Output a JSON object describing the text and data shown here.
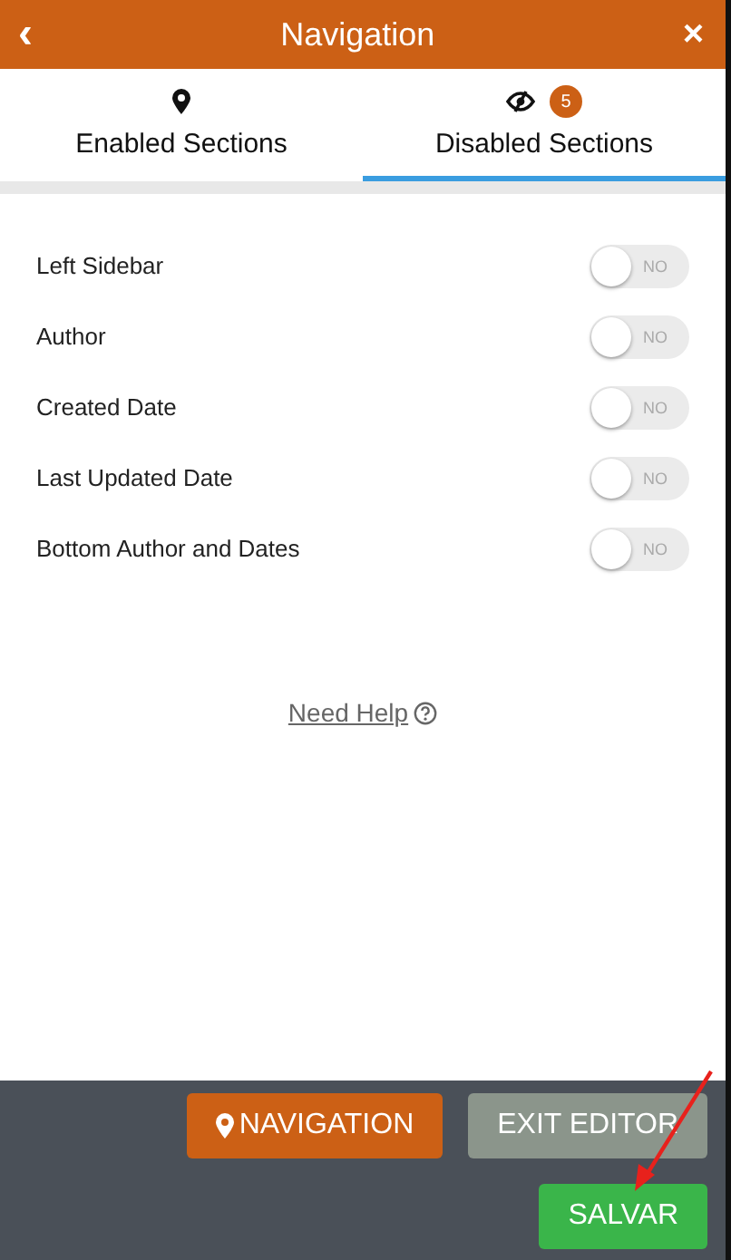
{
  "header": {
    "title": "Navigation",
    "back": "‹",
    "close": "×"
  },
  "tabs": [
    {
      "label": "Enabled Sections",
      "kind": "pin",
      "selected": false
    },
    {
      "label": "Disabled Sections",
      "kind": "eye-slash",
      "badge": "5",
      "selected": true
    }
  ],
  "sections": [
    {
      "name": "Left Sidebar",
      "on": false,
      "toggle_label": "NO"
    },
    {
      "name": "Author",
      "on": false,
      "toggle_label": "NO"
    },
    {
      "name": "Created Date",
      "on": false,
      "toggle_label": "NO"
    },
    {
      "name": "Last Updated Date",
      "on": false,
      "toggle_label": "NO"
    },
    {
      "name": "Bottom Author and Dates",
      "on": false,
      "toggle_label": "NO"
    }
  ],
  "help_link": "Need Help",
  "footer": {
    "buttons": [
      {
        "label": "NAVIGATION",
        "kind": "navigation"
      },
      {
        "label": "EXIT EDITOR",
        "kind": "exit"
      },
      {
        "label": "SALVAR",
        "kind": "save"
      }
    ]
  }
}
